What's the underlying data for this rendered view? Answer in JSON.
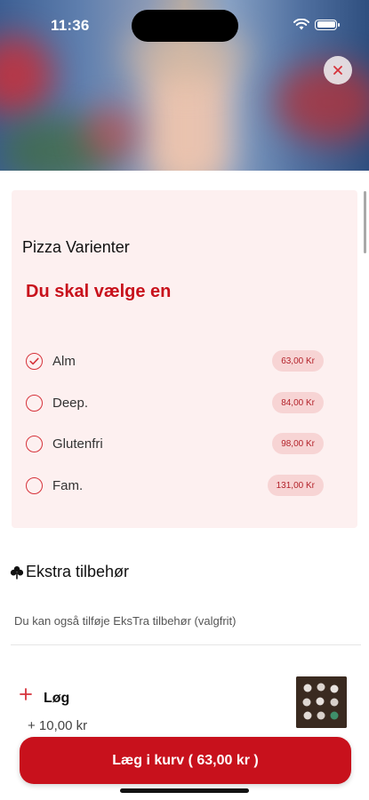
{
  "status_bar": {
    "time": "11:36"
  },
  "header": {
    "close_icon": "close-icon",
    "colors": {
      "close_x": "#d6323a"
    }
  },
  "variants": {
    "title": "Pizza Varienter",
    "required_note": "Du skal vælge en",
    "options": [
      {
        "label": "Alm",
        "price": "63,00 Kr",
        "selected": true
      },
      {
        "label": "Deep.",
        "price": "84,00 Kr",
        "selected": false
      },
      {
        "label": "Glutenfri",
        "price": "98,00 Kr",
        "selected": false
      },
      {
        "label": "Fam.",
        "price": "131,00 Kr",
        "selected": false
      }
    ]
  },
  "extras": {
    "icon": "clover-icon",
    "title": "Ekstra tilbehør",
    "description": "Du kan også tilføje EksTra tilbehør (valgfrit)",
    "items": [
      {
        "name": "Løg",
        "price": "+ 10,00 kr",
        "icon": "plus-icon"
      }
    ]
  },
  "cart_button": {
    "label": "Læg i kurv ( 63,00 kr )"
  },
  "colors": {
    "accent": "#c8111c",
    "card_bg": "#fdf0f0",
    "pill_bg": "#f7d4d4"
  }
}
